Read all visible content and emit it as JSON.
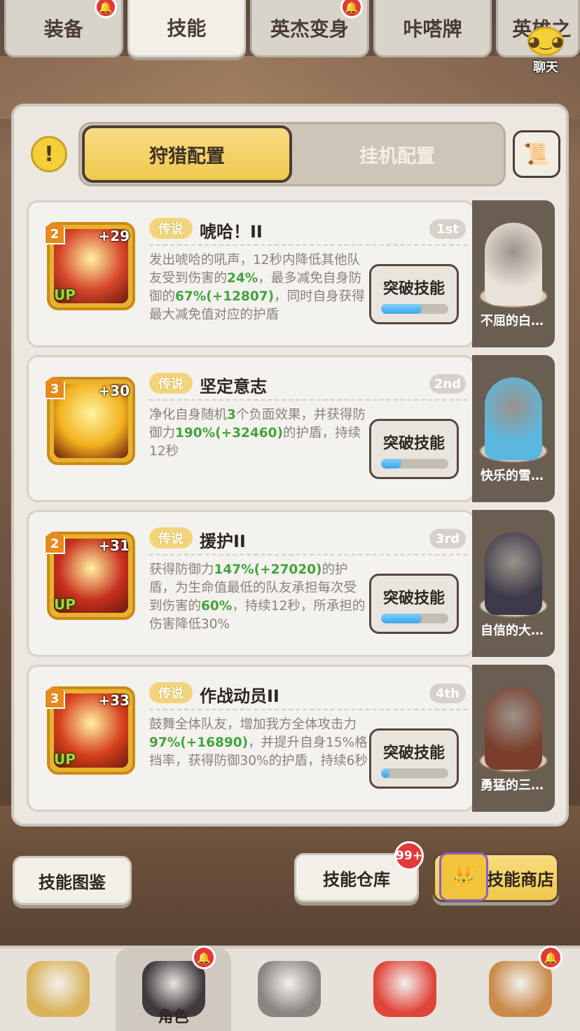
{
  "top_tabs": [
    {
      "label": "装备",
      "alert": true,
      "active": false
    },
    {
      "label": "技能",
      "alert": false,
      "active": true
    },
    {
      "label": "英杰变身",
      "alert": true,
      "active": false
    },
    {
      "label": "咔嗒牌",
      "alert": false,
      "active": false
    },
    {
      "label": "英雄之",
      "alert": false,
      "active": false
    }
  ],
  "chat": {
    "label": "聊天"
  },
  "config": {
    "hunt_label": "狩猎配置",
    "idle_label": "挂机配置",
    "selected": "hunt"
  },
  "skills": [
    {
      "level": "2",
      "plus": "+29",
      "up": "UP",
      "rarity": "传说",
      "name": "唬哈！II",
      "rank": "1st",
      "desc_parts": [
        {
          "t": "发出唬哈的吼声，12秒内降低其他队友受到伤害的",
          "h": false
        },
        {
          "t": "24%",
          "h": true
        },
        {
          "t": "，最多减免自身防御的",
          "h": false
        },
        {
          "t": "67%(+12807)",
          "h": true
        },
        {
          "t": "，同时自身获得最大减免值对应的护盾",
          "h": false
        }
      ],
      "button": "突破技能",
      "progress": 0.6,
      "pet_name": "不屈的白…",
      "icon_color": "#d6452b",
      "pet_color": "#e9e2d8"
    },
    {
      "level": "3",
      "plus": "+30",
      "up": "",
      "rarity": "传说",
      "name": "坚定意志",
      "rank": "2nd",
      "desc_parts": [
        {
          "t": "净化自身随机",
          "h": false
        },
        {
          "t": "3",
          "h": true
        },
        {
          "t": "个负面效果，并获得防御力",
          "h": false
        },
        {
          "t": "190%(+32460)",
          "h": true
        },
        {
          "t": "的护盾，持续12秒",
          "h": false
        }
      ],
      "button": "突破技能",
      "progress": 0.3,
      "pet_name": "快乐的雪…",
      "icon_color": "#f2b21d",
      "pet_color": "#5ab8e0"
    },
    {
      "level": "2",
      "plus": "+31",
      "up": "UP",
      "rarity": "传说",
      "name": "援护II",
      "rank": "3rd",
      "desc_parts": [
        {
          "t": "获得防御力",
          "h": false
        },
        {
          "t": "147%(+27020)",
          "h": true
        },
        {
          "t": "的护盾，为生命值最低的队友承担每次受到伤害的",
          "h": false
        },
        {
          "t": "60%",
          "h": true
        },
        {
          "t": "，持续12秒，所承担的伤害降低30%",
          "h": false
        }
      ],
      "button": "突破技能",
      "progress": 0.6,
      "pet_name": "自信的大…",
      "icon_color": "#c8301e",
      "pet_color": "#3c3a48"
    },
    {
      "level": "3",
      "plus": "+33",
      "up": "UP",
      "rarity": "传说",
      "name": "作战动员II",
      "rank": "4th",
      "desc_parts": [
        {
          "t": "鼓舞全体队友，增加我方全体攻击力",
          "h": false
        },
        {
          "t": "97%(+16890)",
          "h": true
        },
        {
          "t": "，并提升自身15%格挡率，获得防御30%的护盾，持续6秒",
          "h": false
        }
      ],
      "button": "突破技能",
      "progress": 0.12,
      "pet_name": "勇猛的三…",
      "icon_color": "#d8401e",
      "pet_color": "#7a3f2c"
    }
  ],
  "bottom_buttons": {
    "codex": "技能图鉴",
    "warehouse": "技能仓库",
    "warehouse_badge": "99+",
    "shop": "技能商店"
  },
  "nav": {
    "active_label": "角色",
    "items": [
      {
        "name": "nav-item-1",
        "label": "",
        "alert": false,
        "color": "#d9b25a"
      },
      {
        "name": "nav-item-role",
        "label": "角色",
        "alert": true,
        "color": "#3f3a3c"
      },
      {
        "name": "nav-item-3",
        "label": "",
        "alert": false,
        "color": "#8b8580"
      },
      {
        "name": "nav-item-4",
        "label": "",
        "alert": false,
        "color": "#e0453a"
      },
      {
        "name": "nav-item-5",
        "label": "",
        "alert": true,
        "color": "#c98a4a"
      }
    ]
  }
}
